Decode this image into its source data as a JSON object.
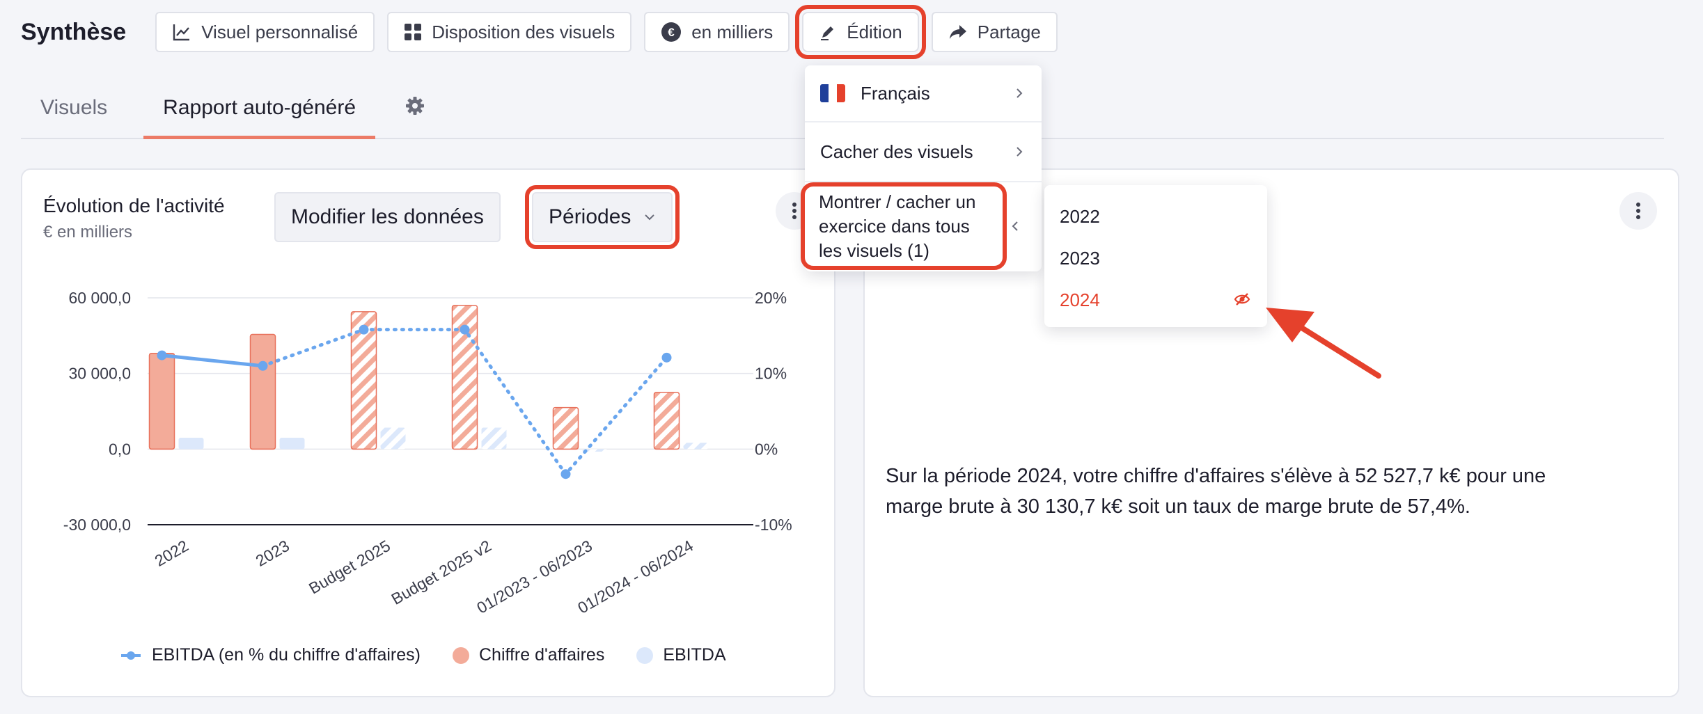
{
  "header": {
    "title": "Synthèse",
    "buttons": {
      "custom_visual": "Visuel personnalisé",
      "layout": "Disposition des visuels",
      "units": "en milliers",
      "edit": "Édition",
      "share": "Partage"
    }
  },
  "tabs": {
    "visuals": "Visuels",
    "report": "Rapport auto-généré"
  },
  "activity_card": {
    "title": "Évolution de l'activité",
    "subtitle": "€ en milliers",
    "edit_data": "Modifier les données",
    "periods": "Périodes"
  },
  "edit_menu": {
    "language": "Français",
    "hide_visuals": "Cacher des visuels",
    "toggle_year_line1": "Montrer / cacher un",
    "toggle_year_line2": "exercice dans tous",
    "toggle_year_line3": "les visuels (1)"
  },
  "year_submenu": {
    "years": [
      "2022",
      "2023",
      "2024"
    ],
    "hidden_year": "2024"
  },
  "report": {
    "text_line1": "Sur la période 2024, votre chiffre d'affaires s'élève à 52 527,7 k€ pour une",
    "text_line2": "marge brute à 30 130,7 k€ soit un taux de marge brute de 57,4%."
  },
  "colors": {
    "accent": "#e5412c",
    "revenue": "#f3ab99",
    "revenue_stroke": "#e8705a",
    "ebitda": "#dce8fb",
    "ebitda_line": "#6aa6ee",
    "tab_underline": "#ec7b67"
  },
  "chart_data": {
    "type": "bar",
    "categories": [
      "2022",
      "2023",
      "Budget 2025",
      "Budget 2025 v2",
      "01/2023 - 06/2023",
      "01/2024 - 06/2024"
    ],
    "ylim": [
      -30000,
      60000
    ],
    "y_ticks": [
      "60 000,0",
      "30 000,0",
      "0,0",
      "-30 000,0"
    ],
    "y2lim": [
      -10,
      20
    ],
    "y2_ticks": [
      "20%",
      "10%",
      "0%",
      "-10%"
    ],
    "hatched_categories": [
      "Budget 2025",
      "Budget 2025 v2",
      "01/2023 - 06/2023",
      "01/2024 - 06/2024"
    ],
    "legend_position": "bottom",
    "series": [
      {
        "name": "Chiffre d'affaires",
        "type": "bar",
        "axis": "left",
        "values": [
          38000,
          45500,
          54500,
          57000,
          16500,
          22500
        ]
      },
      {
        "name": "EBITDA",
        "type": "bar",
        "axis": "left",
        "values": [
          4500,
          4500,
          8500,
          8500,
          -1000,
          2500
        ]
      },
      {
        "name": "EBITDA (en % du chiffre d'affaires)",
        "type": "line",
        "axis": "right",
        "values": [
          12.4,
          11,
          15.8,
          15.8,
          -3.3,
          12.1
        ]
      }
    ]
  }
}
